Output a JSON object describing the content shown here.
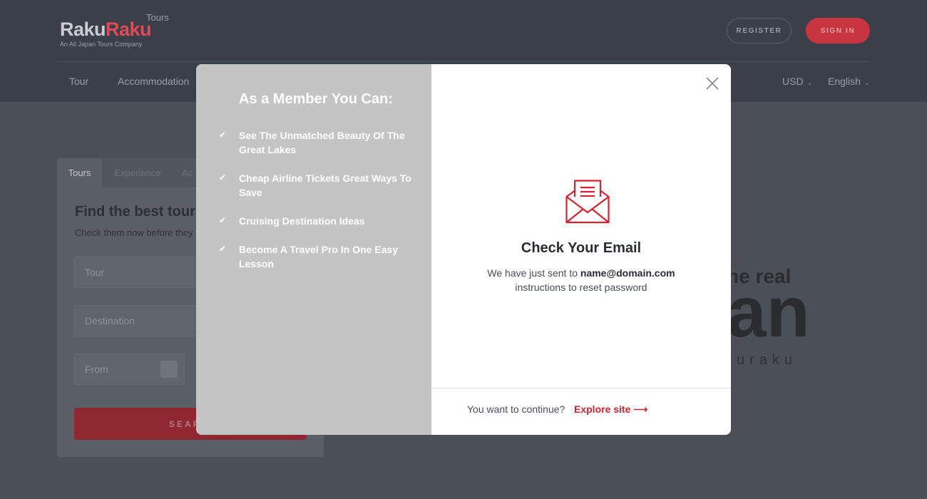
{
  "header": {
    "logo": {
      "part1": "Raku",
      "part2": "Raku",
      "tag": "Tours",
      "tagline": "An All Japan Tours Company"
    },
    "register_label": "REGISTER",
    "signin_label": "SIGN IN",
    "nav": [
      "Tour",
      "Accommodation"
    ],
    "currency": "USD",
    "language": "English"
  },
  "search_card": {
    "tabs": [
      "Tours",
      "Experience",
      "Ac"
    ],
    "title": "Find the best tours",
    "subtitle": "Check them now before they",
    "tour_placeholder": "Tour",
    "destination_placeholder": "Destination",
    "from_placeholder": "From",
    "search_label": "SEAR"
  },
  "hero": {
    "line1": "he real",
    "line2": "an",
    "line3": "uraku"
  },
  "modal": {
    "member_title": "As a Member You Can:",
    "benefits": [
      "See The Unmatched Beauty Of The Great Lakes",
      "Cheap Airline Tickets Great Ways To Save",
      "Cruising Destination Ideas",
      "Become A Travel Pro In One Easy Lesson"
    ],
    "title": "Check Your Email",
    "body_prefix": "We have just sent to ",
    "email": "name@domain.com",
    "body_suffix": "instructions to reset password",
    "footer_question": "You want to continue?",
    "explore_label": "Explore site ⟶",
    "accent_color": "#d8222e"
  }
}
